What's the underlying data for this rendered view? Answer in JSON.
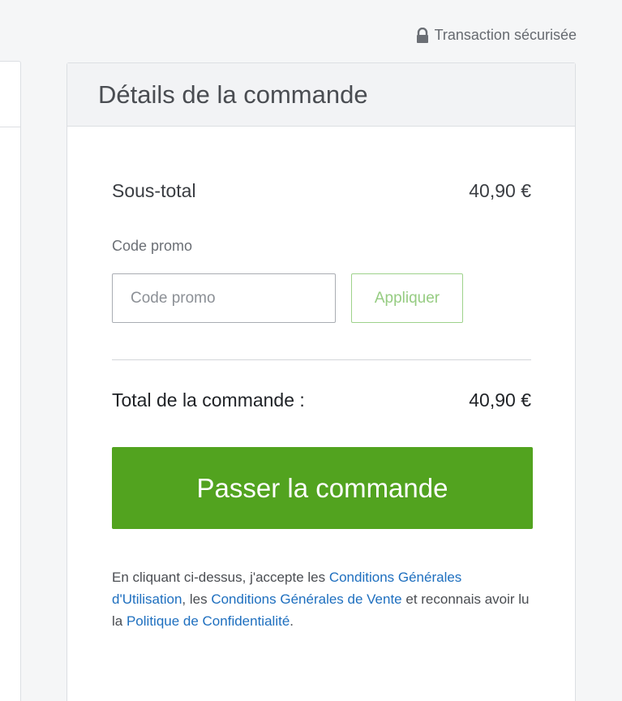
{
  "secure_badge": {
    "icon": "lock-icon",
    "label": "Transaction sécurisée"
  },
  "order_details": {
    "title": "Détails de la commande",
    "subtotal": {
      "label": "Sous-total",
      "value": "40,90 €"
    },
    "promo": {
      "label": "Code promo",
      "input_value": "",
      "placeholder": "Code promo",
      "apply_label": "Appliquer"
    },
    "total": {
      "label": "Total de la commande :",
      "value": "40,90 €"
    },
    "submit_label": "Passer la commande",
    "legal": {
      "part1": "En cliquant ci-dessus, j'accepte les ",
      "link_cgu": "Conditions Générales d'Utilisation",
      "part2": ", les ",
      "link_cgv": "Conditions Générales de Vente",
      "part3": " et reconnais avoir lu la ",
      "link_privacy": "Politique de Confidentialité",
      "part4": "."
    }
  },
  "colors": {
    "primary_button": "#52a31f",
    "apply_button_text": "#96cc82",
    "link": "#1e6fbf",
    "header_bg": "#f2f3f5"
  }
}
